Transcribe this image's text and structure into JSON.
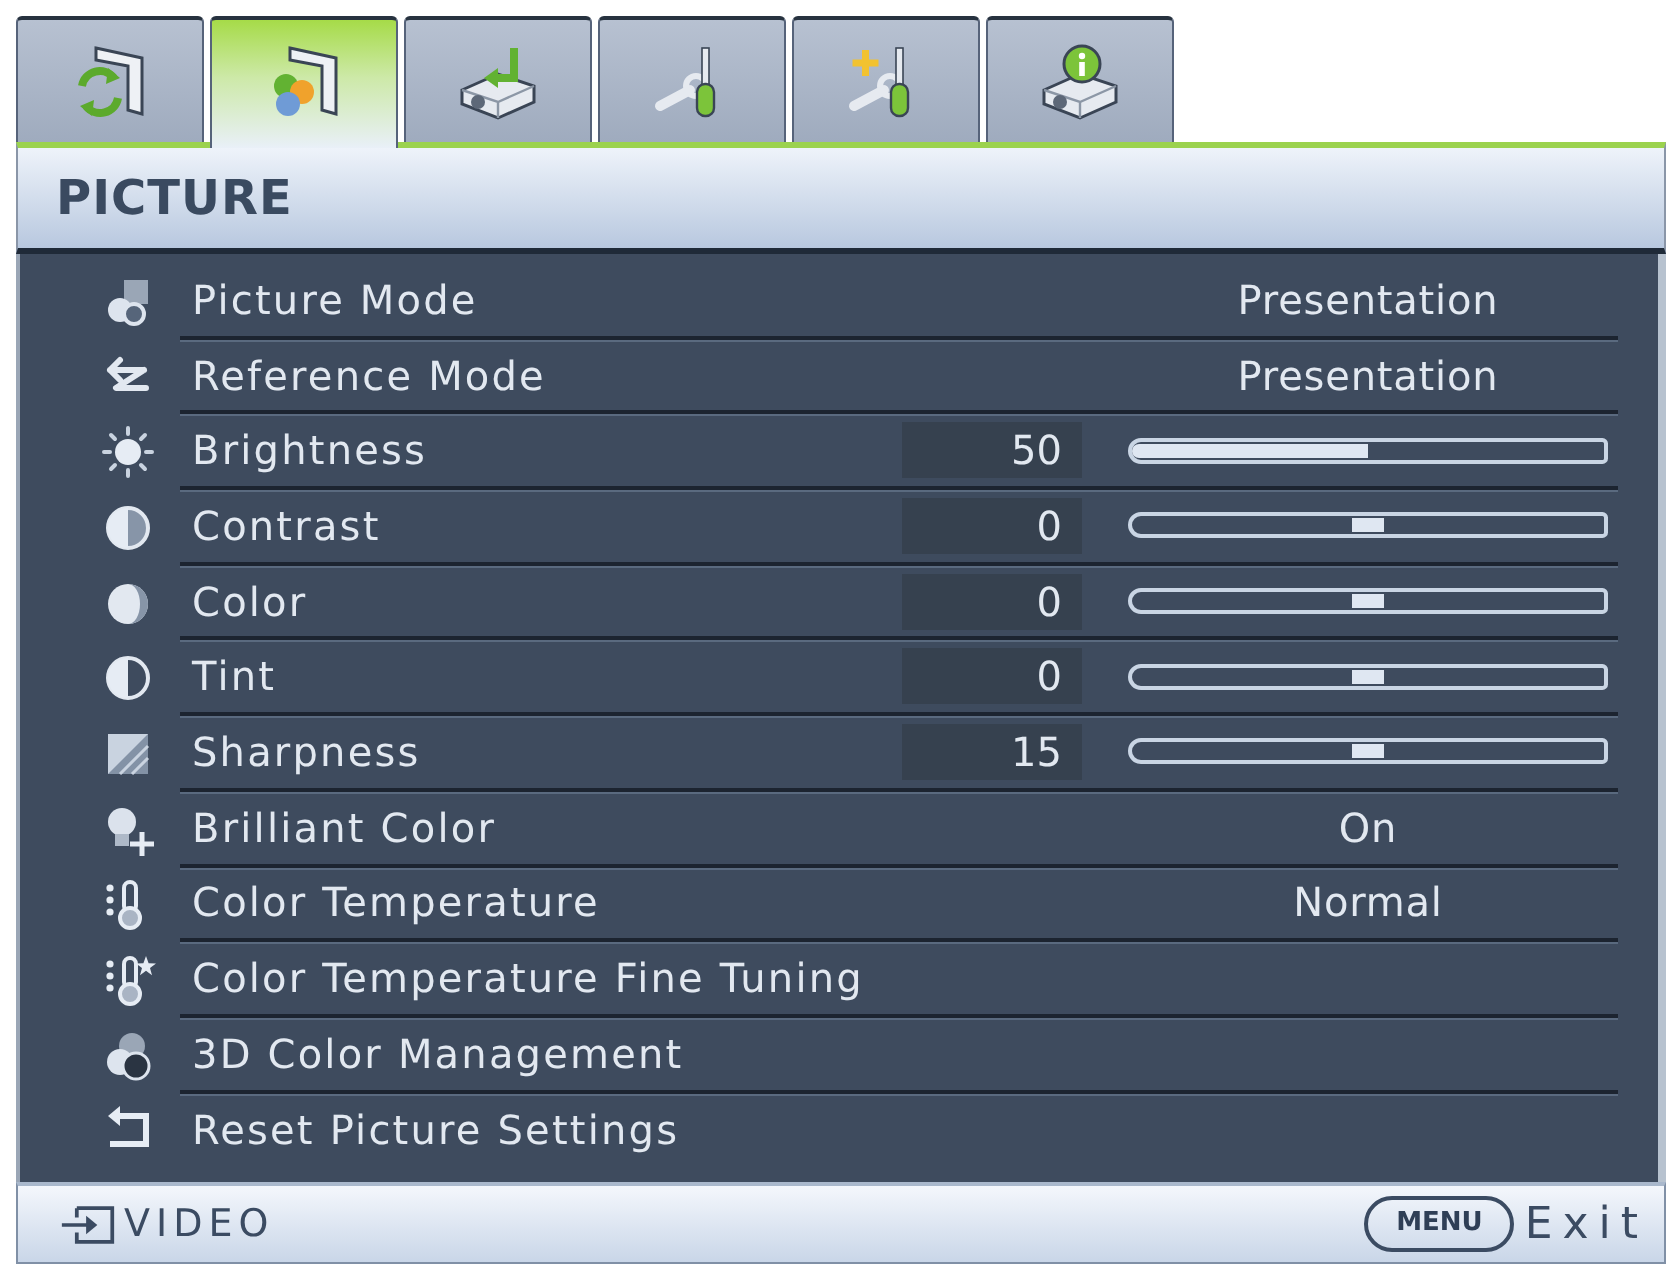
{
  "tabs": [
    {
      "selected": false
    },
    {
      "selected": true
    },
    {
      "selected": false
    },
    {
      "selected": false
    },
    {
      "selected": false
    },
    {
      "selected": false
    }
  ],
  "title": "PICTURE",
  "rows": [
    {
      "kind": "choice",
      "label": "Picture Mode",
      "value": "Presentation"
    },
    {
      "kind": "choice",
      "label": "Reference Mode",
      "value": "Presentation"
    },
    {
      "kind": "bar",
      "label": "Brightness",
      "reading": "50",
      "level": 0.5
    },
    {
      "kind": "balance",
      "label": "Contrast",
      "reading": "0",
      "level": 0.5
    },
    {
      "kind": "balance",
      "label": "Color",
      "reading": "0",
      "level": 0.5
    },
    {
      "kind": "balance",
      "label": "Tint",
      "reading": "0",
      "level": 0.5
    },
    {
      "kind": "balance",
      "label": "Sharpness",
      "reading": "15",
      "level": 0.5
    },
    {
      "kind": "choice",
      "label": "Brilliant Color",
      "value": "On"
    },
    {
      "kind": "choice",
      "label": "Color Temperature",
      "value": "Normal"
    },
    {
      "kind": "submenu",
      "label": "Color Temperature Fine Tuning"
    },
    {
      "kind": "submenu",
      "label": "3D Color Management"
    },
    {
      "kind": "submenu",
      "label": "Reset Picture Settings"
    }
  ],
  "footer": {
    "source": "VIDEO",
    "key": "MENU",
    "action": "Exit"
  }
}
